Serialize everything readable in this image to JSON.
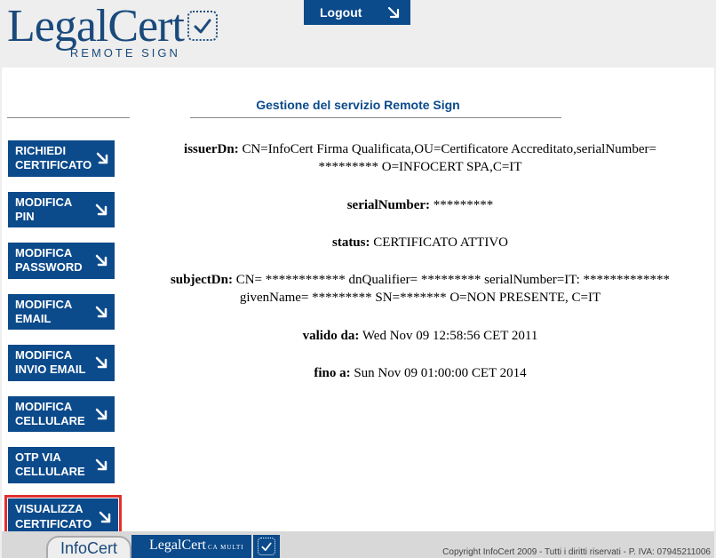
{
  "brand": {
    "name": "LegalCert",
    "sub": "REMOTE SIGN"
  },
  "header": {
    "logout_label": "Logout"
  },
  "page": {
    "title": "Gestione del servizio Remote Sign"
  },
  "sidebar": {
    "items": [
      {
        "label": "RICHIEDI CERTIFICATO"
      },
      {
        "label": "MODIFICA PIN"
      },
      {
        "label": "MODIFICA PASSWORD"
      },
      {
        "label": "MODIFICA EMAIL"
      },
      {
        "label": "MODIFICA INVIO EMAIL"
      },
      {
        "label": "MODIFICA CELLULARE"
      },
      {
        "label": "OTP VIA CELLULARE"
      },
      {
        "label": "VISUALIZZA CERTIFICATO"
      }
    ],
    "highlighted_index": 7
  },
  "certificate": {
    "issuerDn_label": "issuerDn:",
    "issuerDn_value": "CN=InfoCert Firma Qualificata,OU=Certificatore Accreditato,serialNumber= ********* O=INFOCERT SPA,C=IT",
    "serialNumber_label": "serialNumber:",
    "serialNumber_value": "*********",
    "status_label": "status:",
    "status_value": "CERTIFICATO ATTIVO",
    "subjectDn_label": "subjectDn:",
    "subjectDn_value": "CN= ************   dnQualifier= *********   serialNumber=IT: *************      givenName= *********   SN=*******  O=NON PRESENTE, C=IT",
    "validFrom_label": "valido da:",
    "validFrom_value": "Wed Nov 09 12:58:56 CET 2011",
    "validTo_label": "fino a:",
    "validTo_value": "Sun Nov 09 01:00:00 CET 2014"
  },
  "footer": {
    "infocert": "InfoCert",
    "legalcert": "LegalCert",
    "legalcert_sub": "CA MULTI",
    "copyright": "Copyright InfoCert 2009 - Tutti i diritti riservati - P. IVA: 07945211006"
  }
}
